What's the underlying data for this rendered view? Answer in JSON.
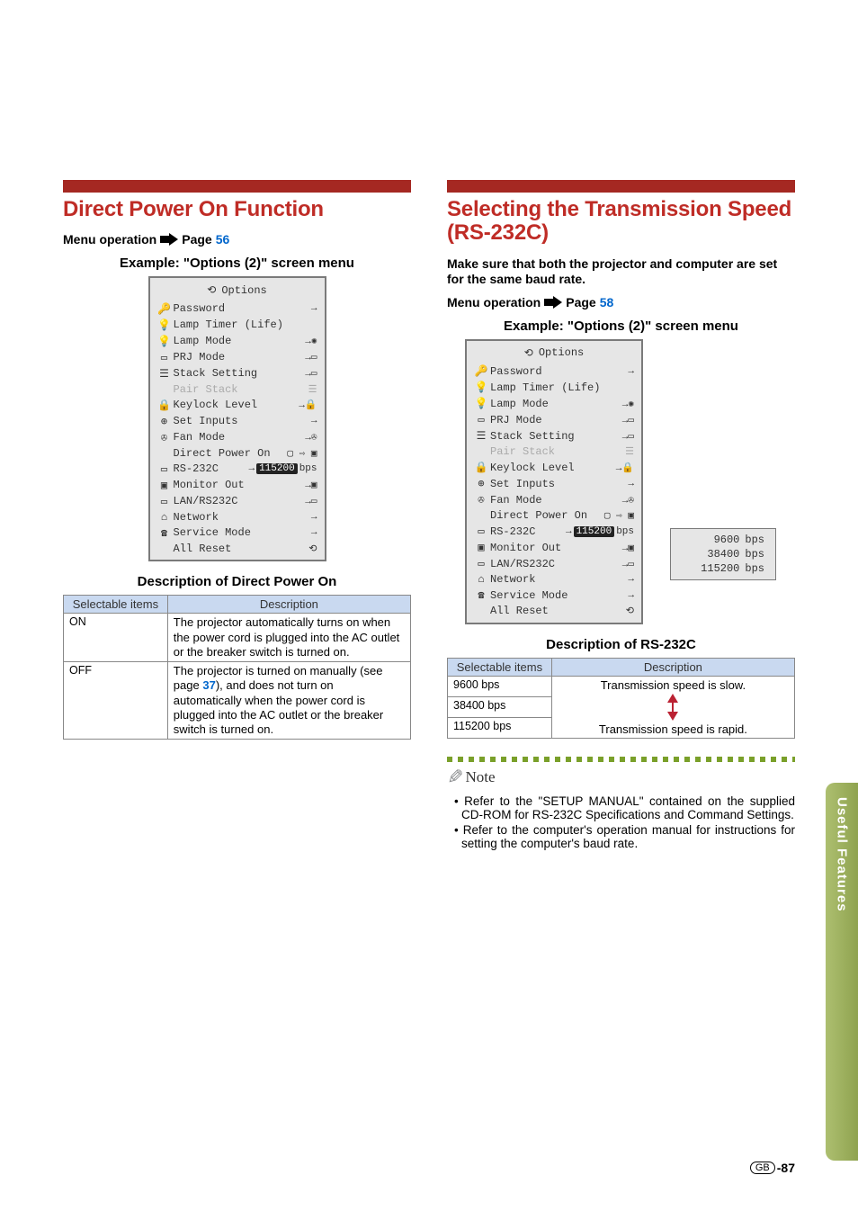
{
  "left": {
    "heading": "Direct Power On Function",
    "menu_op_label": "Menu operation",
    "menu_op_page_label": "Page",
    "menu_op_page_num": "56",
    "example_heading": "Example: \"Options (2)\" screen menu",
    "menu": {
      "title": "Options",
      "items": [
        {
          "icon": "🔑",
          "label": "Password",
          "right": "→"
        },
        {
          "icon": "💡",
          "label": "Lamp Timer (Life)",
          "right": ""
        },
        {
          "icon": "💡",
          "label": "Lamp Mode",
          "right": "→✺"
        },
        {
          "icon": "▭",
          "label": "PRJ Mode",
          "right": "→▭"
        },
        {
          "icon": "☰",
          "label": "Stack Setting",
          "right": "→▭"
        },
        {
          "icon": "",
          "label": "Pair Stack",
          "right": "☰",
          "disabled": true
        },
        {
          "icon": "🔒",
          "label": "Keylock Level",
          "right": "→🔒"
        },
        {
          "icon": "⊕",
          "label": "Set Inputs",
          "right": "→"
        },
        {
          "icon": "✇",
          "label": "Fan Mode",
          "right": "→✇"
        },
        {
          "icon": "",
          "label": "Direct Power On",
          "right": "▢ ⇨ ▣",
          "highlight": true
        },
        {
          "icon": "▭",
          "label": "RS-232C",
          "right": "→ 115200 bps",
          "value_hl": "115200"
        },
        {
          "icon": "▣",
          "label": "Monitor Out",
          "right": "→▣"
        },
        {
          "icon": "▭",
          "label": "LAN/RS232C",
          "right": "→▭"
        },
        {
          "icon": "⌂",
          "label": "Network",
          "right": "→"
        },
        {
          "icon": "☎",
          "label": "Service Mode",
          "right": "→"
        },
        {
          "icon": "",
          "label": "All Reset",
          "right": "⟲"
        }
      ]
    },
    "table_title": "Description of Direct Power On",
    "table_headers": {
      "c1": "Selectable items",
      "c2": "Description"
    },
    "table_rows": [
      {
        "sel": "ON",
        "desc": "The projector automatically turns on when the power cord is plugged into the AC outlet or the breaker switch is turned on."
      },
      {
        "sel": "OFF",
        "desc_pre": "The projector is turned on manually (see page ",
        "page": "37",
        "desc_post": "), and does not turn on automatically when the power cord is plugged into the AC outlet or the breaker switch is turned on."
      }
    ]
  },
  "right": {
    "heading": "Selecting the Transmission Speed (RS-232C)",
    "intro": "Make sure that both the projector and computer are set for the same baud rate.",
    "menu_op_label": "Menu operation",
    "menu_op_page_label": "Page",
    "menu_op_page_num": "58",
    "example_heading": "Example: \"Options (2)\" screen menu",
    "menu": {
      "title": "Options",
      "items": [
        {
          "icon": "🔑",
          "label": "Password",
          "right": "→"
        },
        {
          "icon": "💡",
          "label": "Lamp Timer (Life)",
          "right": ""
        },
        {
          "icon": "💡",
          "label": "Lamp Mode",
          "right": "→✺"
        },
        {
          "icon": "▭",
          "label": "PRJ Mode",
          "right": "→▭"
        },
        {
          "icon": "☰",
          "label": "Stack Setting",
          "right": "→▭"
        },
        {
          "icon": "",
          "label": "Pair Stack",
          "right": "☰",
          "disabled": true
        },
        {
          "icon": "🔒",
          "label": "Keylock Level",
          "right": "→🔒"
        },
        {
          "icon": "⊕",
          "label": "Set Inputs",
          "right": "→"
        },
        {
          "icon": "✇",
          "label": "Fan Mode",
          "right": "→✇"
        },
        {
          "icon": "",
          "label": "Direct Power On",
          "right": "▢ ⇨ ▣"
        },
        {
          "icon": "▭",
          "label": "RS-232C",
          "right": "→ 115200 bps",
          "value_hl": "115200",
          "highlight": true
        },
        {
          "icon": "▣",
          "label": "Monitor Out",
          "right": "→▣"
        },
        {
          "icon": "▭",
          "label": "LAN/RS232C",
          "right": "→▭"
        },
        {
          "icon": "⌂",
          "label": "Network",
          "right": "→"
        },
        {
          "icon": "☎",
          "label": "Service Mode",
          "right": "→"
        },
        {
          "icon": "",
          "label": "All Reset",
          "right": "⟲"
        }
      ]
    },
    "popup": [
      {
        "val": "9600",
        "unit": "bps"
      },
      {
        "val": "38400",
        "unit": "bps"
      },
      {
        "val": "115200",
        "unit": "bps"
      }
    ],
    "table_title": "Description of RS-232C",
    "table_headers": {
      "c1": "Selectable items",
      "c2": "Description"
    },
    "table_rows": [
      {
        "sel": "9600 bps",
        "desc": "Transmission speed is slow."
      },
      {
        "sel": "38400 bps",
        "desc": ""
      },
      {
        "sel": "115200 bps",
        "desc": "Transmission speed is rapid."
      }
    ],
    "note_label": "Note",
    "notes": [
      "Refer to the \"SETUP MANUAL\" contained on the supplied CD-ROM for RS-232C Specifications and Command Settings.",
      "Refer to the computer's operation manual for instructions for setting the computer's baud rate."
    ]
  },
  "side_tab": "Useful Features",
  "footer": {
    "region": "GB",
    "page": "-87"
  }
}
